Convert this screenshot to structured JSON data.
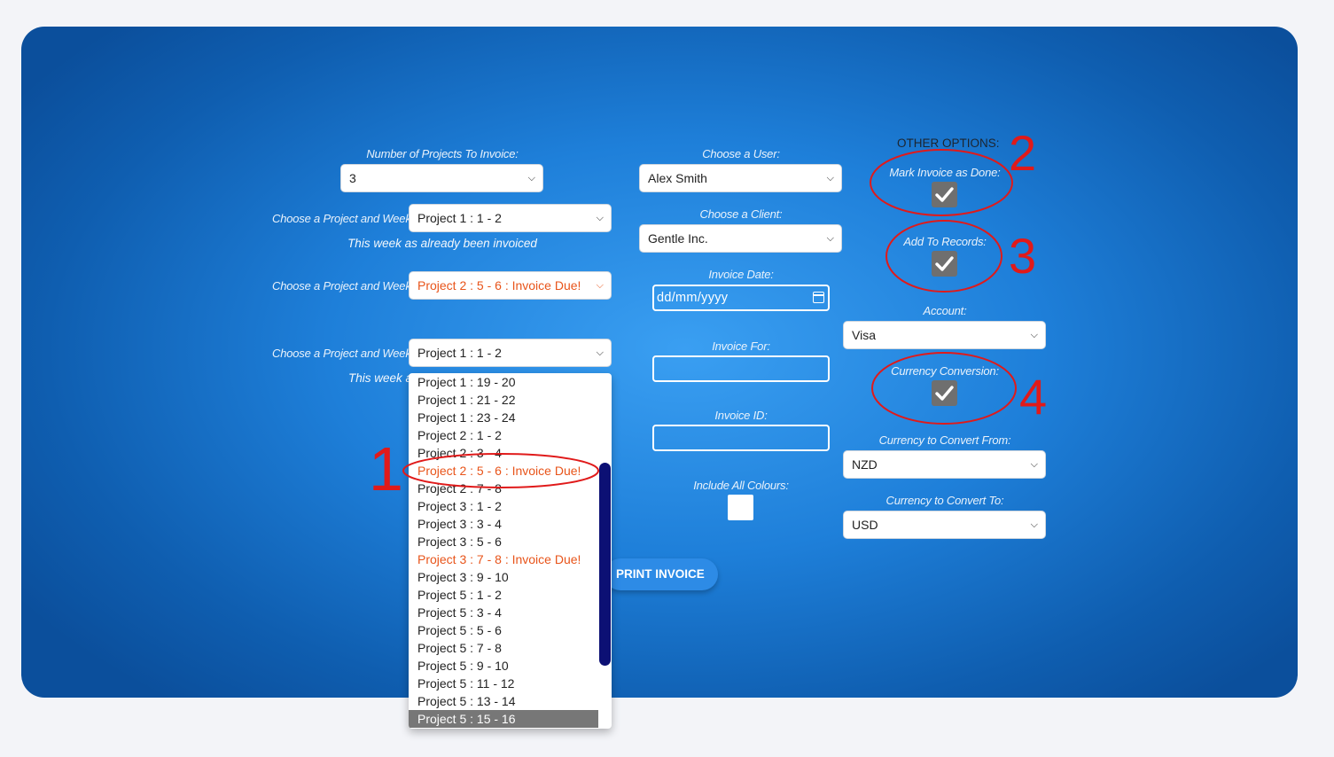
{
  "left": {
    "num_projects_label": "Number of Projects To Invoice:",
    "num_projects_value": "3",
    "project_week_label": "Choose a Project and Week:",
    "select1_value": "Project 1 : 1 - 2",
    "select1_note": "This week as already been invoiced",
    "select2_value": "Project 2 : 5 - 6 : Invoice Due!",
    "select3_value": "Project 1 : 1 - 2",
    "select3_note_partial": "This week a"
  },
  "dropdown": {
    "options": [
      {
        "label": "Project 1 : 19 - 20",
        "due": false
      },
      {
        "label": "Project 1 : 21 - 22",
        "due": false
      },
      {
        "label": "Project 1 : 23 - 24",
        "due": false
      },
      {
        "label": "Project 2 : 1 - 2",
        "due": false
      },
      {
        "label": "Project 2 : 3 - 4",
        "due": false
      },
      {
        "label": "Project 2 : 5 - 6 : Invoice Due!",
        "due": true
      },
      {
        "label": "Project 2 : 7 - 8",
        "due": false
      },
      {
        "label": "Project 3 : 1 - 2",
        "due": false
      },
      {
        "label": "Project 3 : 3 - 4",
        "due": false
      },
      {
        "label": "Project 3 : 5 - 6",
        "due": false
      },
      {
        "label": "Project 3 : 7 - 8 : Invoice Due!",
        "due": true
      },
      {
        "label": "Project 3 : 9 - 10",
        "due": false
      },
      {
        "label": "Project 5 : 1 - 2",
        "due": false
      },
      {
        "label": "Project 5 : 3 - 4",
        "due": false
      },
      {
        "label": "Project 5 : 5 - 6",
        "due": false
      },
      {
        "label": "Project 5 : 7 - 8",
        "due": false
      },
      {
        "label": "Project 5 : 9 - 10",
        "due": false
      },
      {
        "label": "Project 5 : 11 - 12",
        "due": false
      },
      {
        "label": "Project 5 : 13 - 14",
        "due": false
      },
      {
        "label": "Project 5 : 15 - 16",
        "due": false,
        "selected": true
      }
    ]
  },
  "middle": {
    "user_label": "Choose a User:",
    "user_value": "Alex Smith",
    "client_label": "Choose a Client:",
    "client_value": "Gentle Inc.",
    "date_label": "Invoice Date:",
    "date_placeholder": "dd/mm/yyyy",
    "for_label": "Invoice For:",
    "id_label": "Invoice ID:",
    "colours_label": "Include All Colours:",
    "print_label": "PRINT INVOICE"
  },
  "right": {
    "title": "OTHER OPTIONS:",
    "mark_done_label": "Mark Invoice as Done:",
    "add_records_label": "Add To Records:",
    "account_label": "Account:",
    "account_value": "Visa",
    "currency_conversion_label": "Currency Conversion:",
    "convert_from_label": "Currency to Convert From:",
    "convert_from_value": "NZD",
    "convert_to_label": "Currency to Convert To:",
    "convert_to_value": "USD"
  },
  "annotations": {
    "n1": "1",
    "n2": "2",
    "n3": "3",
    "n4": "4",
    "color": "#e01a1a"
  },
  "colors": {
    "panel": "#1e7fd9",
    "due_text": "#e8541a",
    "scrollbar": "#0c1074",
    "checkbox": "#6f6f6f"
  }
}
